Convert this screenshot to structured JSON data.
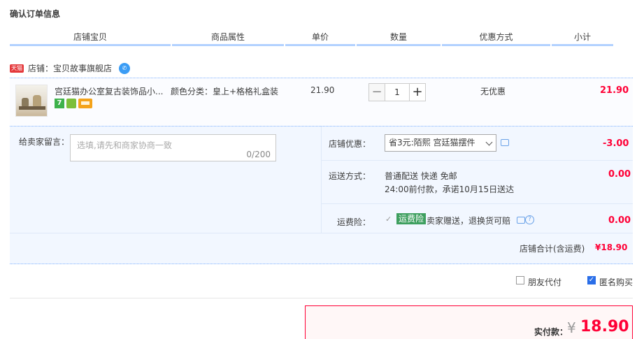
{
  "page": {
    "title": "确认订单信息"
  },
  "table_headers": [
    "店铺宝贝",
    "商品属性",
    "单价",
    "数量",
    "优惠方式",
    "小计"
  ],
  "shop": {
    "badge": "天猫",
    "label": "店铺：宝贝故事旗舰店"
  },
  "item": {
    "title": "宫廷猫办公室复古装饰品小...",
    "attributes": "颜色分类：皇上+格格礼盒装",
    "unit_price": "21.90",
    "quantity": "1",
    "decrease": "−",
    "increase": "+",
    "discount_method": "无优惠",
    "subtotal": "21.90",
    "badge_7": "7"
  },
  "message": {
    "label": "给卖家留言：",
    "placeholder": "选填,请先和商家协商一致",
    "counter": "0/200"
  },
  "shop_discount": {
    "label": "店铺优惠：",
    "selected": "省3元:陌熙 宫廷猫摆件",
    "value": "-3.00"
  },
  "shipping": {
    "label": "运送方式：",
    "line1": "普通配送 快递 免邮",
    "line2": "24:00前付款，承诺10月15日送达",
    "value": "0.00"
  },
  "insurance": {
    "label": "运费险：",
    "tag": "运费险",
    "text": "卖家赠送，退换货可赔",
    "help": "?",
    "value": "0.00"
  },
  "shop_total": {
    "label": "店铺合计(含运费)",
    "value": "¥18.90"
  },
  "options": {
    "friend_pay": "朋友代付",
    "anonymous": "匿名购买",
    "anonymous_checked": true
  },
  "payment": {
    "label": "实付款：",
    "currency": "¥",
    "amount": "18.90"
  }
}
